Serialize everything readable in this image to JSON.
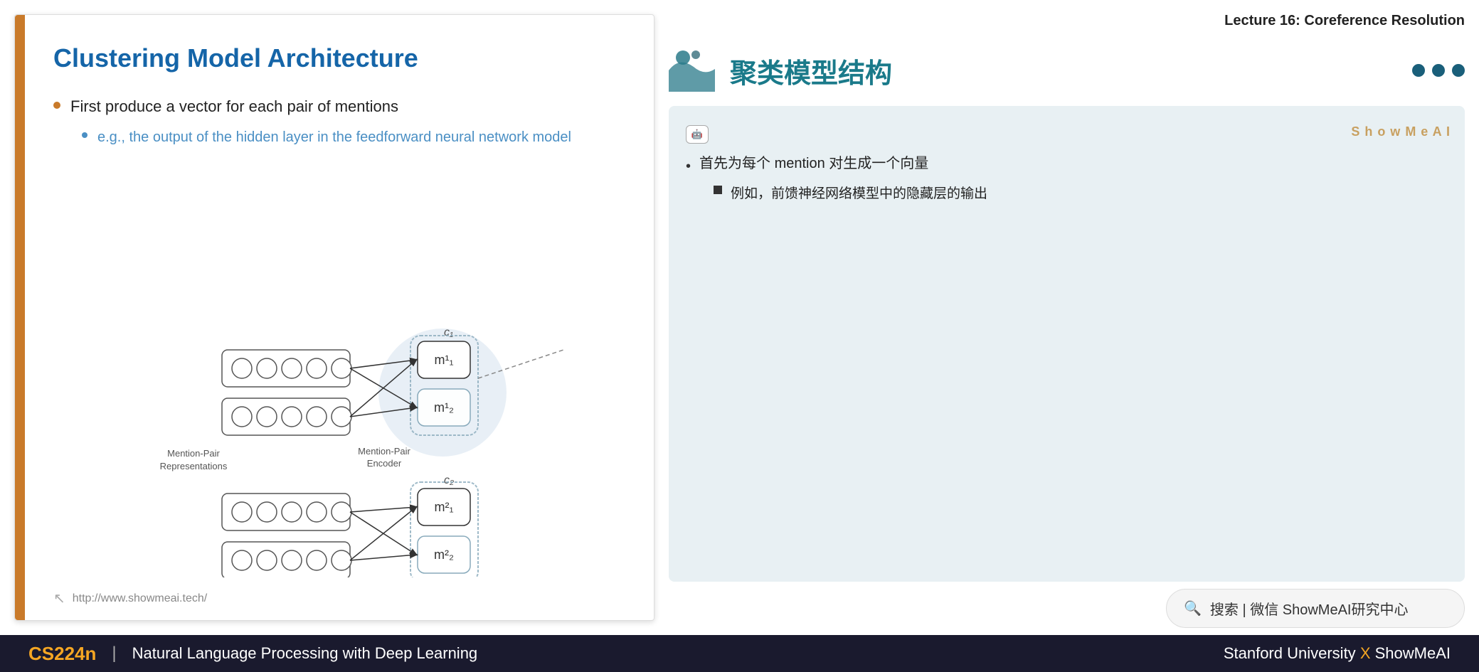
{
  "lecture": {
    "title": "Lecture 16: Coreference Resolution"
  },
  "slide": {
    "title": "Clustering Model Architecture",
    "bullets": [
      {
        "text": "First produce a vector for each pair of mentions",
        "sub": [
          {
            "text": "e.g., the output of the hidden layer in the feedforward neural network model"
          }
        ]
      }
    ],
    "footer_url": "http://www.showmeai.tech/"
  },
  "cn_card": {
    "title": "聚类模型结构",
    "nav_dots": [
      "dot1",
      "dot2",
      "dot3"
    ]
  },
  "translation": {
    "ai_badge": "🤖",
    "watermark": "S h o w M e A I",
    "bullets": [
      {
        "text": "首先为每个 mention 对生成一个向量",
        "sub": [
          {
            "text": "例如，前馈神经网络模型中的隐藏层的输出"
          }
        ]
      }
    ]
  },
  "search": {
    "text": "搜索 | 微信 ShowMeAI研究中心"
  },
  "bottom_bar": {
    "cs_label": "CS224n",
    "divider": "|",
    "course_name": "Natural Language Processing with Deep Learning",
    "university": "Stanford University",
    "x_symbol": "X",
    "brand": "ShowMeAI"
  },
  "diagram": {
    "label_mention_pair_rep": "Mention-Pair\nRepresentations",
    "label_mention_pair_enc": "Mention-Pair\nEncoder",
    "label_c1": "c₁",
    "label_c2": "c₂",
    "label_m11": "m¹₁",
    "label_m12": "m¹₂",
    "label_m21": "m²₁",
    "label_m22": "m²₂"
  }
}
